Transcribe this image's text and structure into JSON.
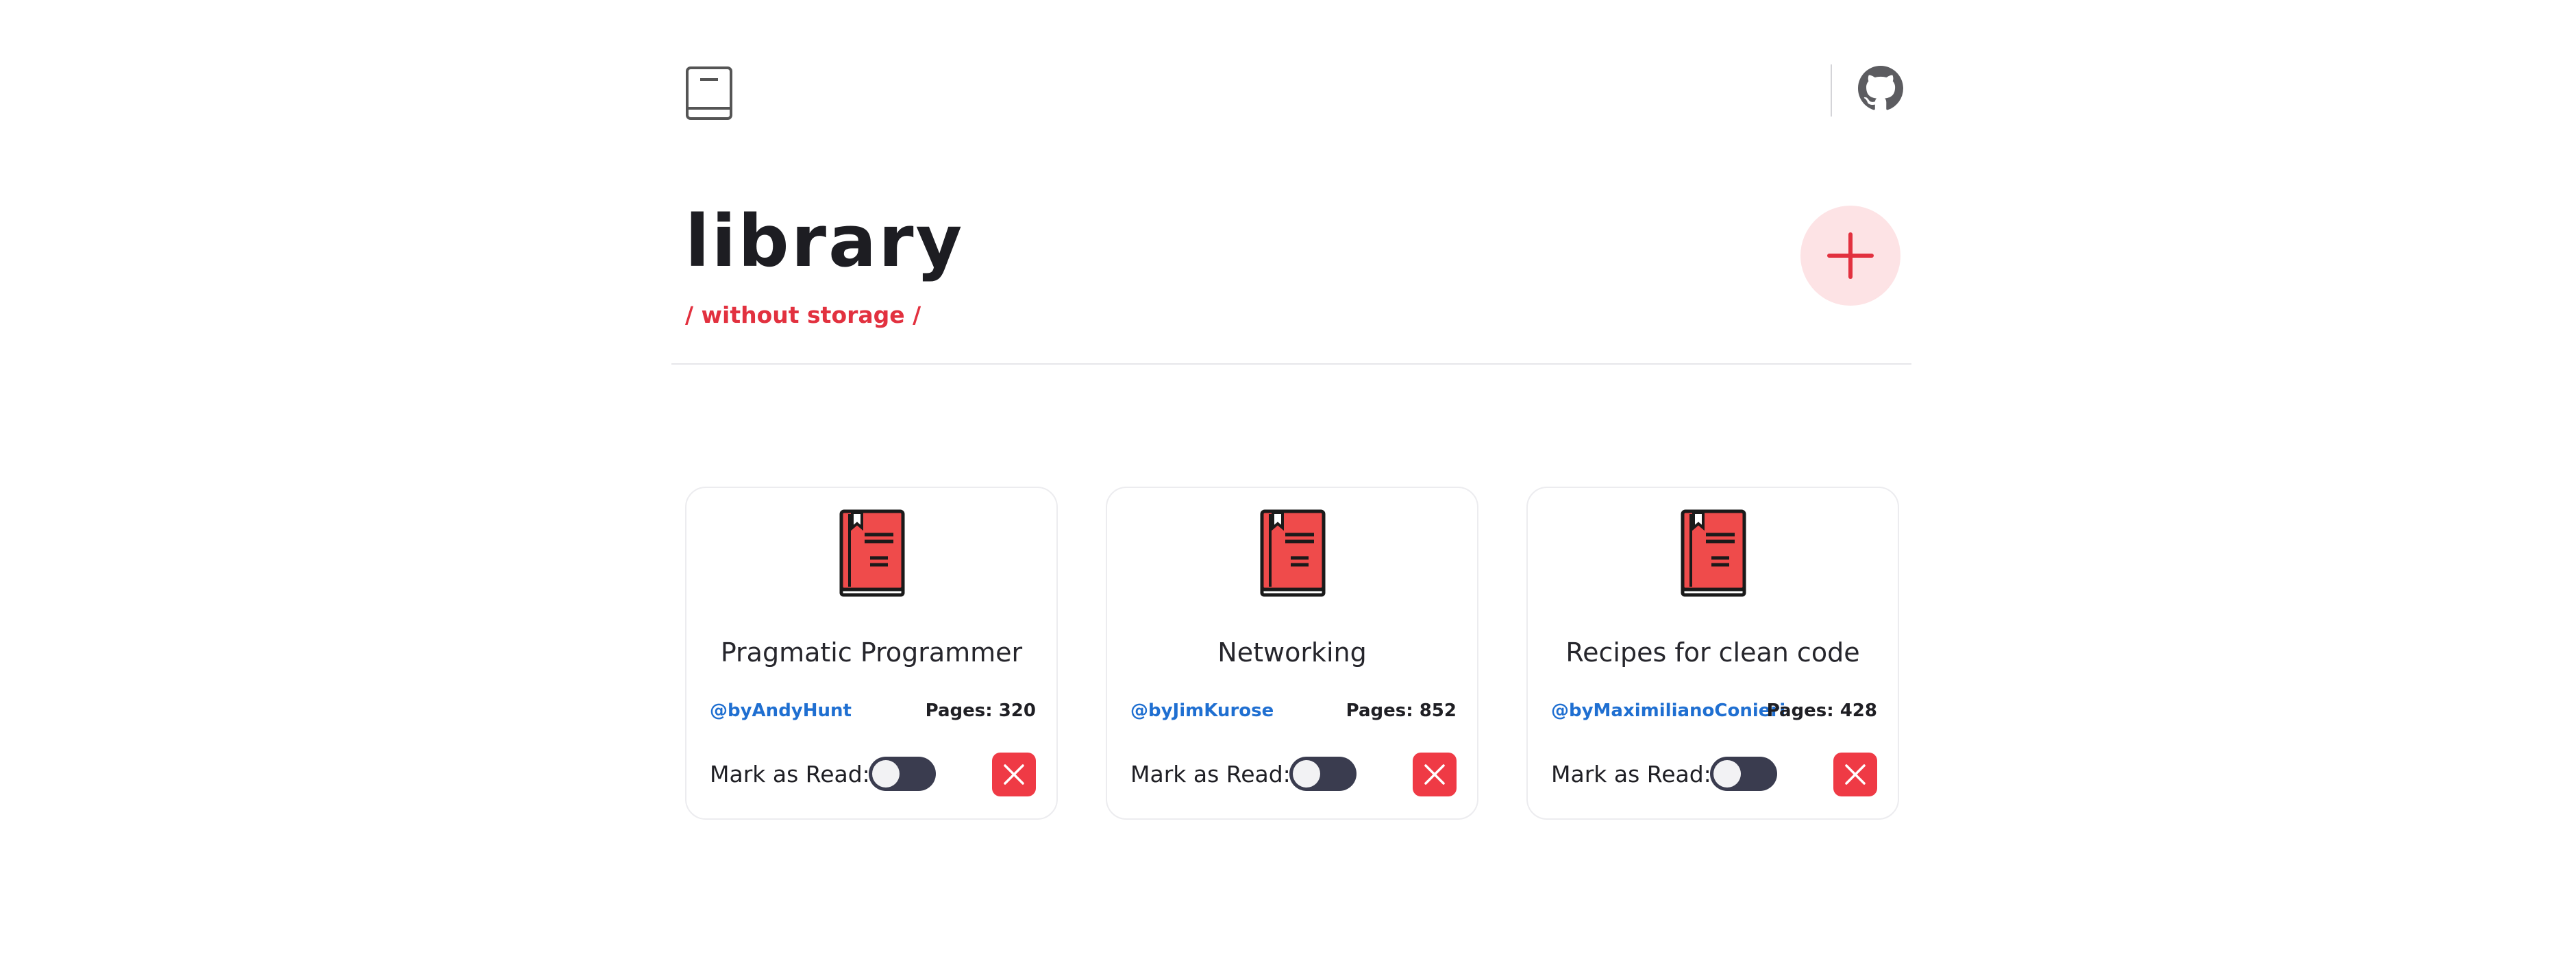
{
  "header": {
    "logo_icon": "book-outline-icon",
    "github_icon": "github-icon"
  },
  "hero": {
    "title": "library",
    "subtitle": "/ without storage /",
    "add_icon": "plus-icon",
    "accent_color": "#e2313f",
    "add_button_bg": "#fde3e5"
  },
  "books": [
    {
      "title": "Pragmatic Programmer",
      "author": "@byAndyHunt",
      "pages": "Pages: 320",
      "read_label": "Mark as Read:",
      "read": false
    },
    {
      "title": "Networking",
      "author": "@byJimKurose",
      "pages": "Pages: 852",
      "read_label": "Mark as Read:",
      "read": false
    },
    {
      "title": "Recipes for clean code",
      "author": "@byMaximilianoConieri",
      "pages": "Pages: 428",
      "read_label": "Mark as Read:",
      "read": false
    }
  ],
  "colors": {
    "book_red": "#ef4b4b",
    "link_blue": "#1f6fd1",
    "toggle_dark": "#3a3c4f",
    "delete_red": "#ef3a45"
  }
}
